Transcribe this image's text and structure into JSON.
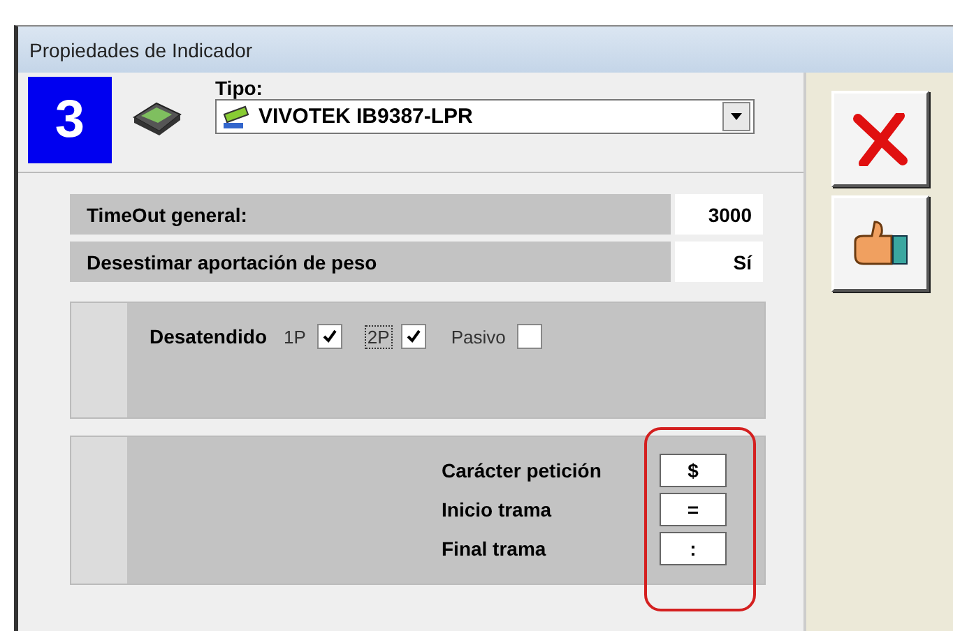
{
  "window": {
    "title": "Propiedades de Indicador"
  },
  "indicator": {
    "number": "3",
    "type_label": "Tipo:",
    "type_value": "VIVOTEK IB9387-LPR"
  },
  "settings": [
    {
      "label": "TimeOut general:",
      "value": "3000"
    },
    {
      "label": "Desestimar aportación de peso",
      "value": "Sí"
    }
  ],
  "unattended": {
    "label": "Desatendido",
    "options": [
      {
        "label": "1P",
        "checked": true,
        "focused": false
      },
      {
        "label": "2P",
        "checked": true,
        "focused": true
      },
      {
        "label": "Pasivo",
        "checked": false,
        "focused": false
      }
    ]
  },
  "frame": [
    {
      "label": "Carácter petición",
      "value": "$"
    },
    {
      "label": "Inicio trama",
      "value": "="
    },
    {
      "label": "Final trama",
      "value": ":"
    }
  ],
  "annotation": {
    "color": "#d42020"
  }
}
